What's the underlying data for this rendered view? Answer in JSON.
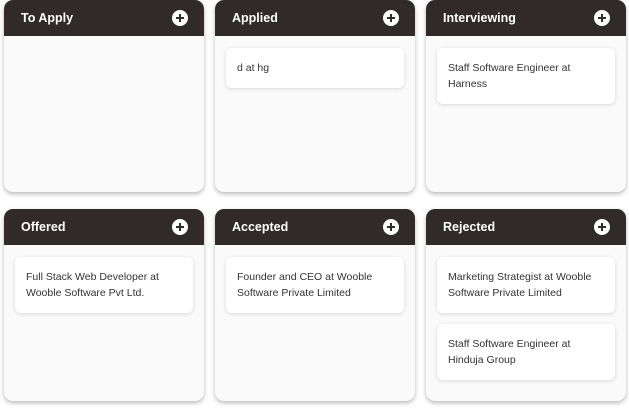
{
  "columns": [
    {
      "title": "To Apply",
      "cards": []
    },
    {
      "title": "Applied",
      "cards": [
        "d at hg"
      ]
    },
    {
      "title": "Interviewing",
      "cards": [
        "Staff Software Engineer at Harness"
      ]
    },
    {
      "title": "Offered",
      "cards": [
        "Full Stack Web Developer at Wooble Software Pvt Ltd."
      ]
    },
    {
      "title": "Accepted",
      "cards": [
        "Founder and CEO at Wooble Software Private Limited"
      ]
    },
    {
      "title": "Rejected",
      "cards": [
        "Marketing Strategist at Wooble Software Private Limited",
        "Staff Software Engineer at Hinduja Group"
      ]
    }
  ],
  "colors": {
    "header_bg": "#302b29",
    "column_bg": "#fafafa",
    "card_bg": "#ffffff",
    "text": "#333333"
  },
  "icons": {
    "add": "plus-circle-icon"
  }
}
